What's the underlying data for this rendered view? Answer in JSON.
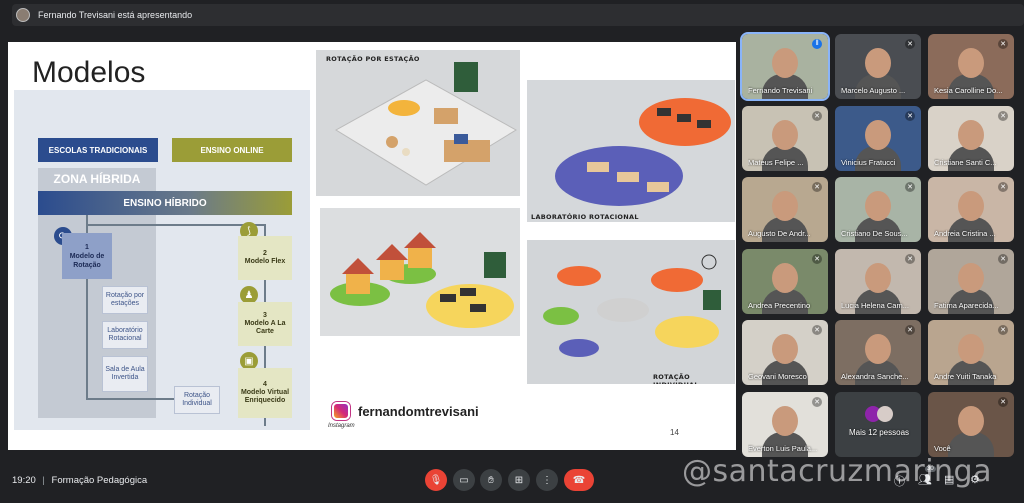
{
  "header": {
    "presenting_text": "Fernando Trevisani está apresentando"
  },
  "slide": {
    "title": "Modelos",
    "diagram": {
      "traditional": "ESCOLAS TRADICIONAIS",
      "online": "ENSINO ONLINE",
      "zone": "ZONA HÍBRIDA",
      "hybrid": "ENSINO HÍBRIDO",
      "model1_num": "1",
      "model1": "Modelo de Rotação",
      "sub1": "Rotação por estações",
      "sub2": "Laboratório Rotacional",
      "sub3": "Sala de Aula Invertida",
      "sub4": "Rotação Individual",
      "model2_num": "2",
      "model2": "Modelo Flex",
      "model3_num": "3",
      "model3": "Modelo A La Carte",
      "model4_num": "4",
      "model4": "Modelo Virtual Enriquecido"
    },
    "captions": {
      "top_left": "ROTAÇÃO POR ESTAÇÃO",
      "mid_right": "LABORATÓRIO ROTACIONAL",
      "bottom_right": "ROTAÇÃO INDIVIDUAL"
    },
    "instagram_word": "Instagram",
    "instagram_handle": "fernandomtrevisani",
    "page_number": "14"
  },
  "participants": [
    {
      "name": "Fernando Trevisani",
      "active": true,
      "bg": "#a9b2a0"
    },
    {
      "name": "Marcelo Augusto ...",
      "active": false,
      "bg": "#4a4d52"
    },
    {
      "name": "Kesia Carolline Do...",
      "active": false,
      "bg": "#8b6b5a"
    },
    {
      "name": "Mateus Felipe ...",
      "active": false,
      "bg": "#c8c2b4"
    },
    {
      "name": "Vinicius Fratucci",
      "active": false,
      "bg": "#3c5a8a"
    },
    {
      "name": "Cristiane Santi C...",
      "active": false,
      "bg": "#d9d2c8"
    },
    {
      "name": "Augusto De Andr...",
      "active": false,
      "bg": "#b8a890"
    },
    {
      "name": "Cristiano De Sous...",
      "active": false,
      "bg": "#a8b4a6"
    },
    {
      "name": "Andreia Cristina ...",
      "active": false,
      "bg": "#c9b6a6"
    },
    {
      "name": "Andrea Precentino",
      "active": false,
      "bg": "#7a8a6a"
    },
    {
      "name": "Lucia Helena Cam...",
      "active": false,
      "bg": "#c2b8ae"
    },
    {
      "name": "Fatima Aparecida...",
      "active": false,
      "bg": "#b0a69a"
    },
    {
      "name": "Geovani Moresco",
      "active": false,
      "bg": "#d4d0c8"
    },
    {
      "name": "Alexandra Sanche...",
      "active": false,
      "bg": "#7d6e62"
    },
    {
      "name": "Andre Yuiti Tanaka",
      "active": false,
      "bg": "#b9a58f"
    },
    {
      "name": "Everton Luis Paula...",
      "active": false,
      "bg": "#e2e0da"
    },
    {
      "name": "Mais 12 pessoas",
      "active": false,
      "bg": "#3c4043"
    },
    {
      "name": "Você",
      "active": false,
      "bg": "#6a5548"
    }
  ],
  "footer": {
    "time": "19:20",
    "separator": "|",
    "meeting_name": "Formação Pedagógica",
    "participant_count_badge": "30",
    "watermark": "@santacruzmaringa"
  },
  "colors": {
    "background": "#202124",
    "accent_blue": "#2b4c8e",
    "accent_olive": "#9b9d37",
    "danger": "#ea4335",
    "active_outline": "#8ab4f8"
  },
  "icons": [
    "mic-off-icon",
    "camera-icon",
    "raise-hand-icon",
    "present-icon",
    "more-options-icon",
    "hang-up-icon",
    "info-icon",
    "people-icon",
    "chat-icon",
    "activities-icon"
  ]
}
